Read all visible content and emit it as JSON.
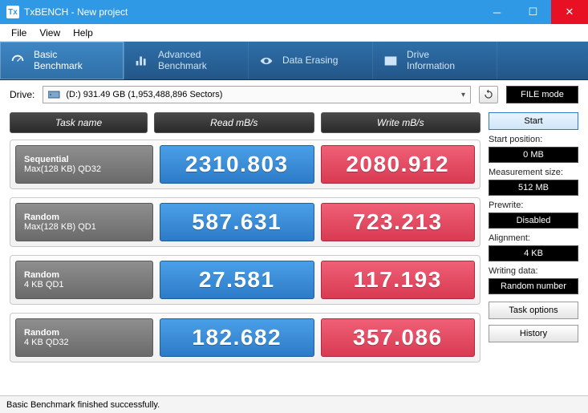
{
  "window": {
    "title": "TxBENCH - New project"
  },
  "menu": {
    "file": "File",
    "view": "View",
    "help": "Help"
  },
  "tabs": [
    {
      "line1": "Basic",
      "line2": "Benchmark"
    },
    {
      "line1": "Advanced",
      "line2": "Benchmark"
    },
    {
      "line1": "Data Erasing",
      "line2": ""
    },
    {
      "line1": "Drive",
      "line2": "Information"
    }
  ],
  "drive": {
    "label": "Drive:",
    "selection": "(D:)   931.49 GB (1,953,488,896 Sectors)",
    "file_mode": "FILE mode"
  },
  "headers": {
    "task": "Task name",
    "read": "Read mB/s",
    "write": "Write mB/s"
  },
  "rows": [
    {
      "name1": "Sequential",
      "name2": "Max(128 KB) QD32",
      "read": "2310.803",
      "write": "2080.912"
    },
    {
      "name1": "Random",
      "name2": "Max(128 KB) QD1",
      "read": "587.631",
      "write": "723.213"
    },
    {
      "name1": "Random",
      "name2": "4 KB QD1",
      "read": "27.581",
      "write": "117.193"
    },
    {
      "name1": "Random",
      "name2": "4 KB QD32",
      "read": "182.682",
      "write": "357.086"
    }
  ],
  "side": {
    "start": "Start",
    "start_pos_label": "Start position:",
    "start_pos": "0 MB",
    "meas_label": "Measurement size:",
    "meas": "512 MB",
    "prewrite_label": "Prewrite:",
    "prewrite": "Disabled",
    "align_label": "Alignment:",
    "align": "4 KB",
    "wdata_label": "Writing data:",
    "wdata": "Random number",
    "task_options": "Task options",
    "history": "History"
  },
  "status": "Basic Benchmark finished successfully."
}
